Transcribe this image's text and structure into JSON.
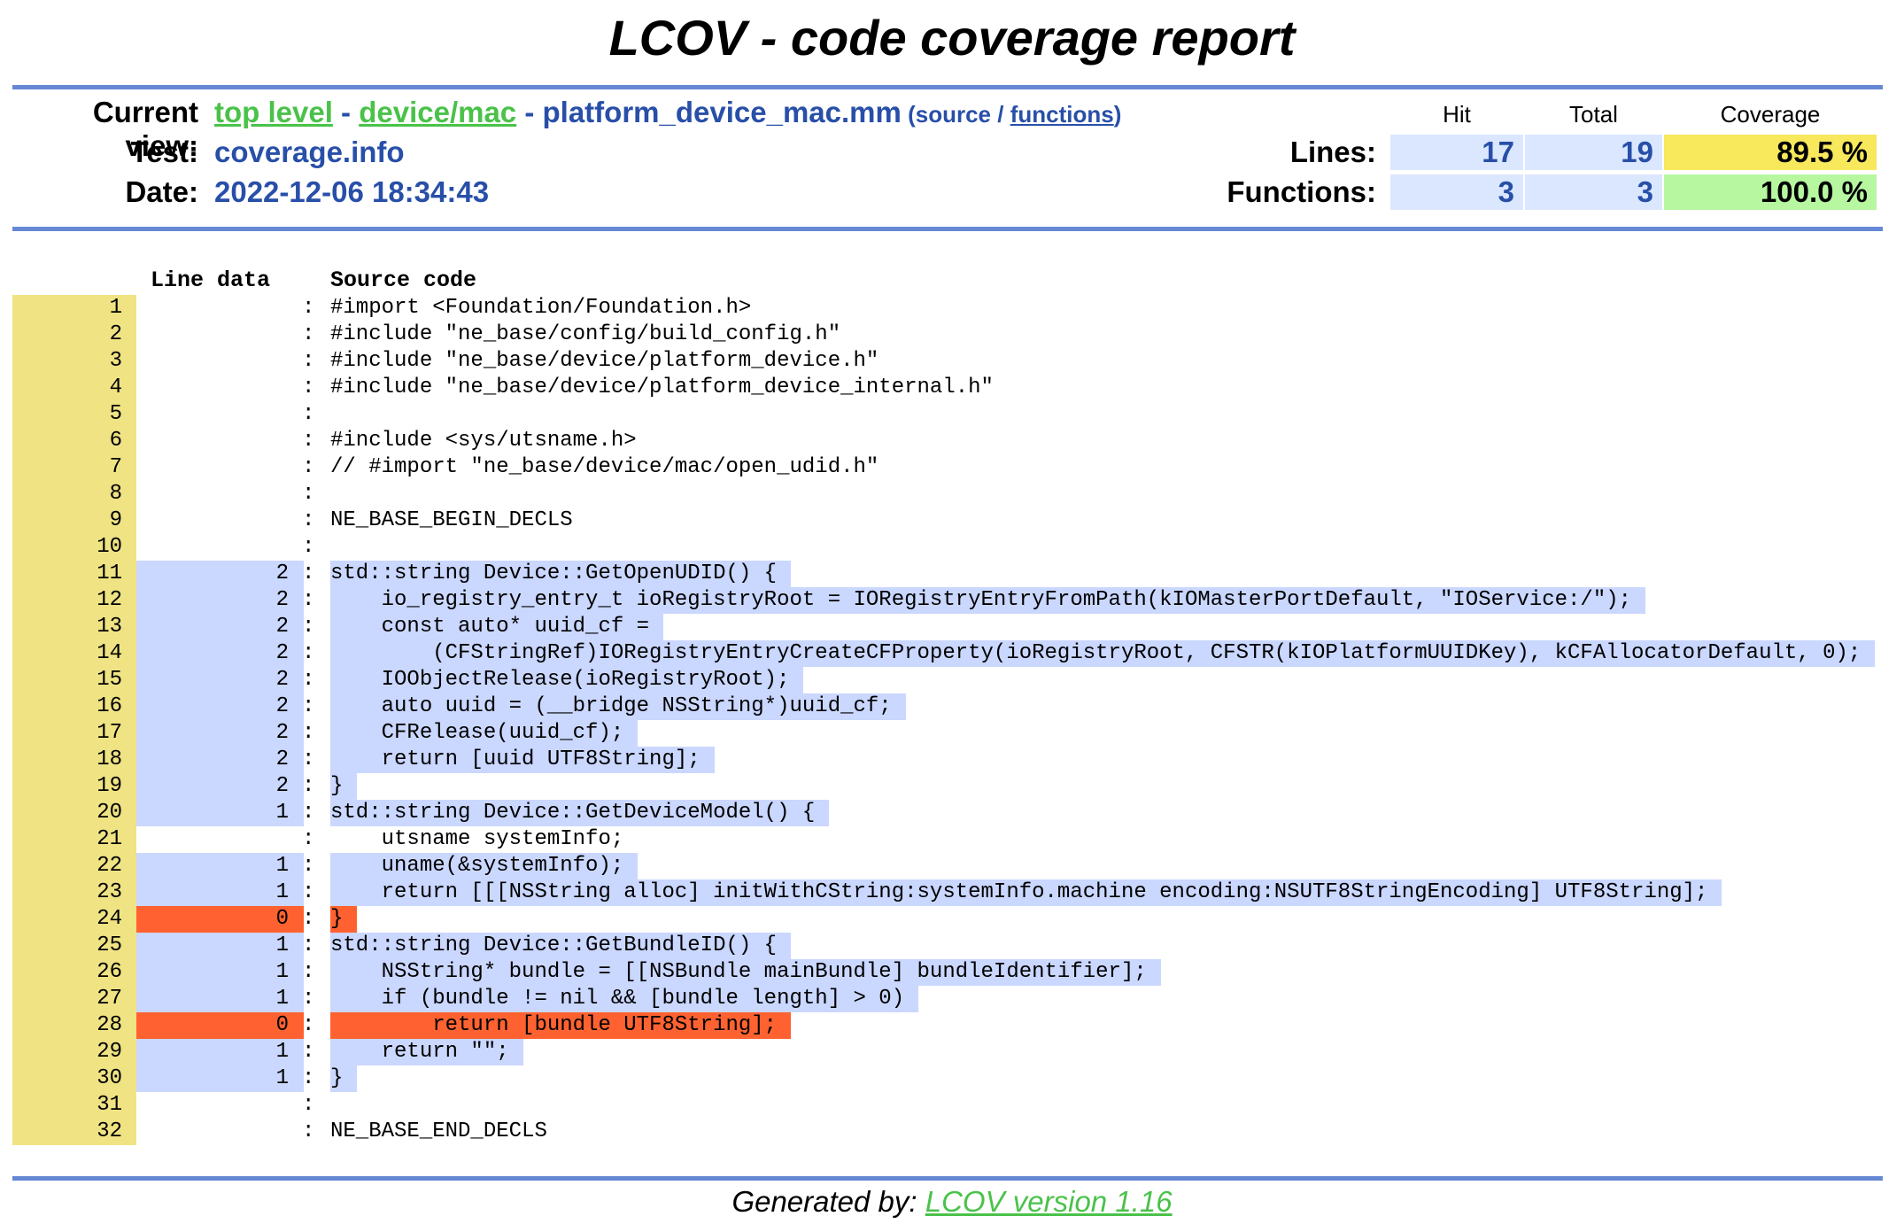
{
  "title": "LCOV - code coverage report",
  "header": {
    "current_view_label": "Current view:",
    "crumbs": {
      "top_level": "top level",
      "sep1": " - ",
      "dir": "device/mac",
      "sep2": " - ",
      "file": "platform_device_mac.mm",
      "paren_open": " (",
      "source": "source",
      "slash": " / ",
      "functions": "functions",
      "paren_close": ")"
    },
    "test_label": "Test:",
    "test_value": "coverage.info",
    "date_label": "Date:",
    "date_value": "2022-12-06 18:34:43"
  },
  "summary": {
    "columns": {
      "hit": "Hit",
      "total": "Total",
      "coverage": "Coverage"
    },
    "lines": {
      "label": "Lines:",
      "hit": "17",
      "total": "19",
      "coverage": "89.5 %",
      "coverage_color": "#f7e85c"
    },
    "functions": {
      "label": "Functions:",
      "hit": "3",
      "total": "3",
      "coverage": "100.0 %",
      "coverage_color": "#b6f7a0"
    }
  },
  "code_header": {
    "line_data": "Line data",
    "source_code": "Source code"
  },
  "colors": {
    "covered": "#cad7fe",
    "uncovered": "#ff6230",
    "line_number": "#efe383",
    "rule": "#6688d4"
  },
  "source_lines": [
    {
      "n": "1",
      "count": "",
      "status": "none",
      "code": "#import <Foundation/Foundation.h>"
    },
    {
      "n": "2",
      "count": "",
      "status": "none",
      "code": "#include \"ne_base/config/build_config.h\""
    },
    {
      "n": "3",
      "count": "",
      "status": "none",
      "code": "#include \"ne_base/device/platform_device.h\""
    },
    {
      "n": "4",
      "count": "",
      "status": "none",
      "code": "#include \"ne_base/device/platform_device_internal.h\""
    },
    {
      "n": "5",
      "count": "",
      "status": "none",
      "code": ""
    },
    {
      "n": "6",
      "count": "",
      "status": "none",
      "code": "#include <sys/utsname.h>"
    },
    {
      "n": "7",
      "count": "",
      "status": "none",
      "code": "// #import \"ne_base/device/mac/open_udid.h\""
    },
    {
      "n": "8",
      "count": "",
      "status": "none",
      "code": ""
    },
    {
      "n": "9",
      "count": "",
      "status": "none",
      "code": "NE_BASE_BEGIN_DECLS"
    },
    {
      "n": "10",
      "count": "",
      "status": "none",
      "code": ""
    },
    {
      "n": "11",
      "count": "2",
      "status": "covered",
      "code": "std::string Device::GetOpenUDID() {"
    },
    {
      "n": "12",
      "count": "2",
      "status": "covered",
      "code": "    io_registry_entry_t ioRegistryRoot = IORegistryEntryFromPath(kIOMasterPortDefault, \"IOService:/\");"
    },
    {
      "n": "13",
      "count": "2",
      "status": "covered",
      "code": "    const auto* uuid_cf ="
    },
    {
      "n": "14",
      "count": "2",
      "status": "covered",
      "code": "        (CFStringRef)IORegistryEntryCreateCFProperty(ioRegistryRoot, CFSTR(kIOPlatformUUIDKey), kCFAllocatorDefault, 0);"
    },
    {
      "n": "15",
      "count": "2",
      "status": "covered",
      "code": "    IOObjectRelease(ioRegistryRoot);"
    },
    {
      "n": "16",
      "count": "2",
      "status": "covered",
      "code": "    auto uuid = (__bridge NSString*)uuid_cf;"
    },
    {
      "n": "17",
      "count": "2",
      "status": "covered",
      "code": "    CFRelease(uuid_cf);"
    },
    {
      "n": "18",
      "count": "2",
      "status": "covered",
      "code": "    return [uuid UTF8String];"
    },
    {
      "n": "19",
      "count": "2",
      "status": "covered",
      "code": "}"
    },
    {
      "n": "20",
      "count": "1",
      "status": "covered",
      "code": "std::string Device::GetDeviceModel() {"
    },
    {
      "n": "21",
      "count": "",
      "status": "none",
      "code": "    utsname systemInfo;"
    },
    {
      "n": "22",
      "count": "1",
      "status": "covered",
      "code": "    uname(&systemInfo);"
    },
    {
      "n": "23",
      "count": "1",
      "status": "covered",
      "code": "    return [[[NSString alloc] initWithCString:systemInfo.machine encoding:NSUTF8StringEncoding] UTF8String];"
    },
    {
      "n": "24",
      "count": "0",
      "status": "uncovered",
      "code": "}"
    },
    {
      "n": "25",
      "count": "1",
      "status": "covered",
      "code": "std::string Device::GetBundleID() {"
    },
    {
      "n": "26",
      "count": "1",
      "status": "covered",
      "code": "    NSString* bundle = [[NSBundle mainBundle] bundleIdentifier];"
    },
    {
      "n": "27",
      "count": "1",
      "status": "covered",
      "code": "    if (bundle != nil && [bundle length] > 0)"
    },
    {
      "n": "28",
      "count": "0",
      "status": "uncovered",
      "code": "        return [bundle UTF8String];"
    },
    {
      "n": "29",
      "count": "1",
      "status": "covered",
      "code": "    return \"\";"
    },
    {
      "n": "30",
      "count": "1",
      "status": "covered",
      "code": "}"
    },
    {
      "n": "31",
      "count": "",
      "status": "none",
      "code": ""
    },
    {
      "n": "32",
      "count": "",
      "status": "none",
      "code": "NE_BASE_END_DECLS"
    }
  ],
  "footer": {
    "prefix": "Generated by: ",
    "link": "LCOV version 1.16"
  }
}
